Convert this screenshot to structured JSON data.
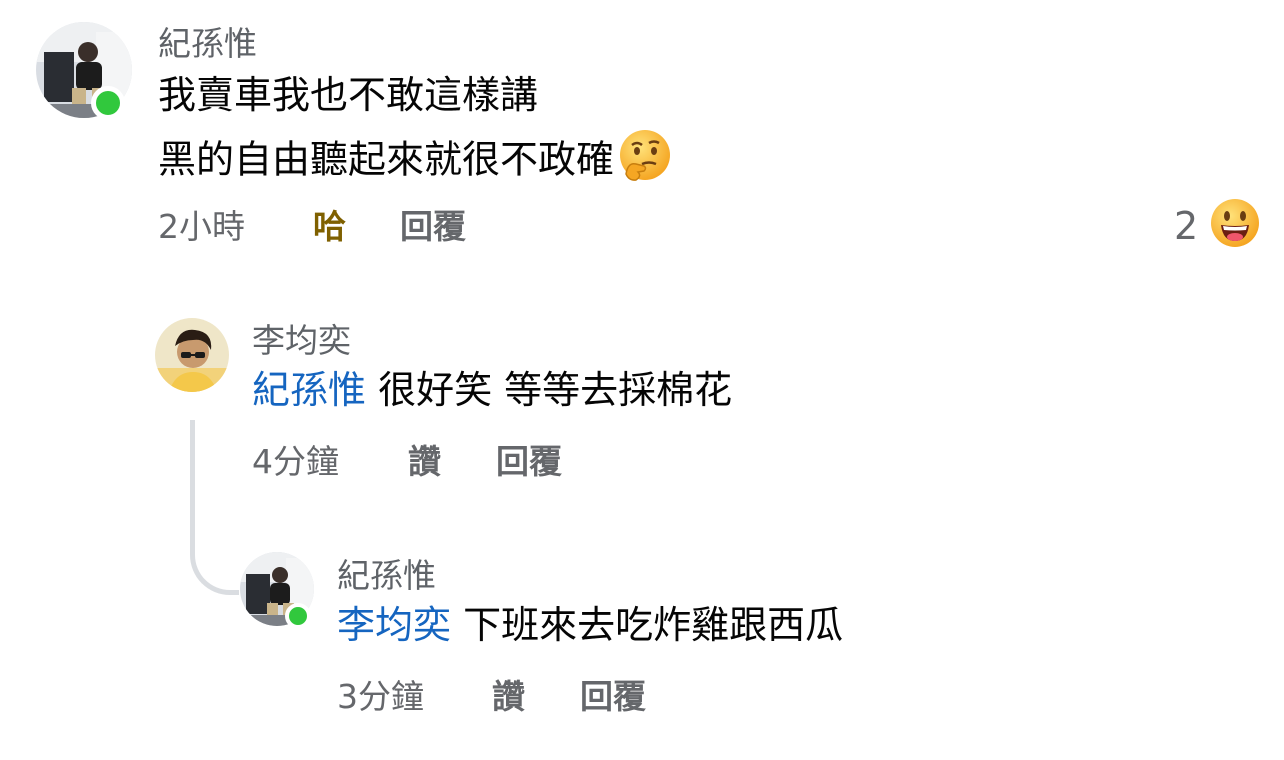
{
  "comment": {
    "author": "紀孫惟",
    "lines": [
      "我賣車我也不敢這樣講",
      "黑的自由聽起來就很不政確"
    ],
    "emoji": "thinking-face",
    "time": "2小時",
    "reaction_label": "哈",
    "reply_label": "回覆",
    "reaction_count": "2",
    "reaction_emoji": "grinning-face"
  },
  "replies": [
    {
      "author": "李均奕",
      "mention": "紀孫惟",
      "text": " 很好笑 等等去採棉花",
      "time": "4分鐘",
      "like_label": "讚",
      "reply_label": "回覆"
    },
    {
      "author": "紀孫惟",
      "mention": "李均奕",
      "text": " 下班來去吃炸雞跟西瓜",
      "time": "3分鐘",
      "like_label": "讚",
      "reply_label": "回覆"
    }
  ],
  "colors": {
    "mention": "#1565c0",
    "reacted": "#7f6000",
    "online": "#31c83d",
    "meta": "#65676b"
  }
}
